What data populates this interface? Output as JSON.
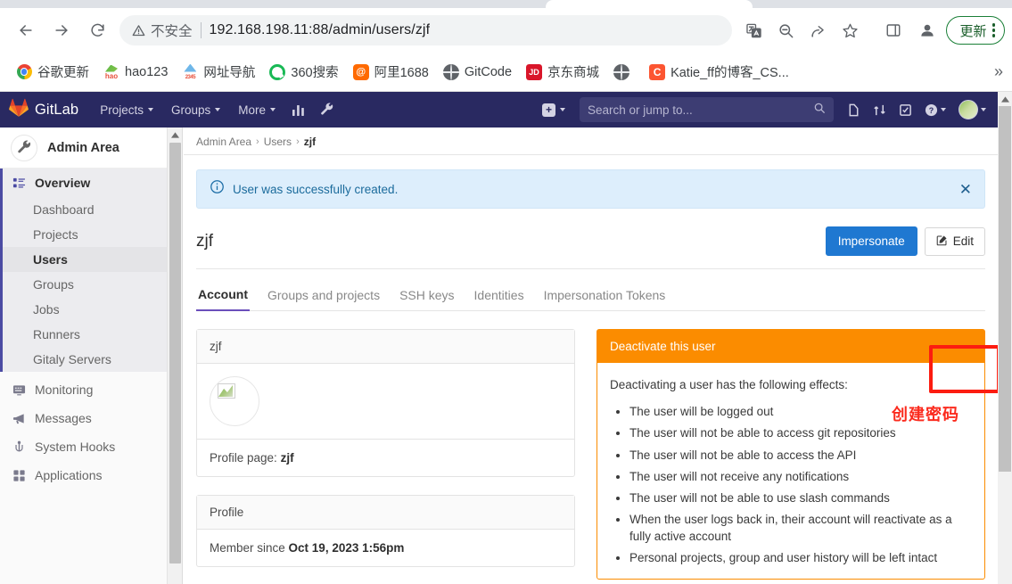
{
  "browser": {
    "nav": {
      "back": "back-arrow",
      "forward": "forward-arrow",
      "reload": "reload-arrow"
    },
    "omnibox": {
      "warning_label": "不安全",
      "url_host": "192.168.198.11:88",
      "url_path": "/admin/users/zjf",
      "full_url": "192.168.198.11:88/admin/users/zjf"
    },
    "toolbar_icons": [
      "translate-icon",
      "zoom-out-icon",
      "share-icon",
      "bookmark-star-icon",
      "side-panel-icon",
      "profile-avatar-icon"
    ],
    "update_button": "更新",
    "bookmarks": [
      {
        "label": "谷歌更新",
        "icon": "chrome-icon"
      },
      {
        "label": "hao123",
        "icon": "hao123-icon"
      },
      {
        "label": "网址导航",
        "icon": "2345-icon"
      },
      {
        "label": "360搜索",
        "icon": "360-icon"
      },
      {
        "label": "阿里1688",
        "icon": "alibaba-icon"
      },
      {
        "label": "GitCode",
        "icon": "globe-icon"
      },
      {
        "label": "京东商城",
        "icon": "jd-icon"
      },
      {
        "label": "",
        "icon": "globe-icon"
      },
      {
        "label": "Katie_ff的博客_CS...",
        "icon": "csdn-icon"
      }
    ],
    "bookmarks_overflow": "»"
  },
  "gitlab": {
    "brand": "GitLab",
    "nav_items": [
      {
        "label": "Projects",
        "caret": true
      },
      {
        "label": "Groups",
        "caret": true
      },
      {
        "label": "More",
        "caret": true
      }
    ],
    "nav_icons": [
      "analytics-chart-icon",
      "wrench-admin-icon"
    ],
    "search": {
      "placeholder": "Search or jump to...",
      "value": "",
      "icon": "search-icon"
    },
    "right_icons": [
      "issues-icon",
      "merge-requests-icon",
      "todos-icon",
      "help-question-icon",
      "user-avatar-icon"
    ],
    "create_new": "plus-icon"
  },
  "sidebar": {
    "header": {
      "label": "Admin Area",
      "icon": "wrench-icon"
    },
    "group_label": "Overview",
    "group_icon": "overview-grid-icon",
    "sub_items": [
      {
        "label": "Dashboard",
        "active": false
      },
      {
        "label": "Projects",
        "active": false
      },
      {
        "label": "Users",
        "active": true
      },
      {
        "label": "Groups",
        "active": false
      },
      {
        "label": "Jobs",
        "active": false
      },
      {
        "label": "Runners",
        "active": false
      },
      {
        "label": "Gitaly Servers",
        "active": false
      }
    ],
    "bottom_items": [
      {
        "label": "Monitoring",
        "icon": "monitor-icon"
      },
      {
        "label": "Messages",
        "icon": "megaphone-icon"
      },
      {
        "label": "System Hooks",
        "icon": "hooks-anchor-icon"
      },
      {
        "label": "Applications",
        "icon": "applications-grid-icon"
      }
    ]
  },
  "main": {
    "breadcrumb": {
      "items": [
        "Admin Area",
        "Users"
      ],
      "current": "zjf",
      "separator": "›"
    },
    "alert": {
      "icon": "info-circle-icon",
      "message": "User was successfully created.",
      "close": "✕"
    },
    "page_title": "zjf",
    "buttons": {
      "impersonate": "Impersonate",
      "edit": "Edit",
      "edit_icon": "pencil-square-icon"
    },
    "annotation": "创建密码",
    "annotation_color": "#fb2b1e",
    "tabs": [
      {
        "label": "Account",
        "active": true
      },
      {
        "label": "Groups and projects",
        "active": false
      },
      {
        "label": "SSH keys",
        "active": false
      },
      {
        "label": "Identities",
        "active": false
      },
      {
        "label": "Impersonation Tokens",
        "active": false
      }
    ],
    "user_card": {
      "title": "zjf",
      "avatar": "user-avatar-image",
      "profile_label": "Profile page:",
      "profile_value": "zjf"
    },
    "profile_card": {
      "title": "Profile",
      "member_since_label": "Member since",
      "member_since_value": "Oct 19, 2023 1:56pm"
    },
    "deactivate_card": {
      "title": "Deactivate this user",
      "intro": "Deactivating a user has the following effects:",
      "effects": [
        "The user will be logged out",
        "The user will not be able to access git repositories",
        "The user will not be able to access the API",
        "The user will not receive any notifications",
        "The user will not be able to use slash commands",
        "When the user logs back in, their account will reactivate as a fully active account",
        "Personal projects, group and user history will be left intact"
      ],
      "accent_color": "#fb8c00"
    }
  }
}
